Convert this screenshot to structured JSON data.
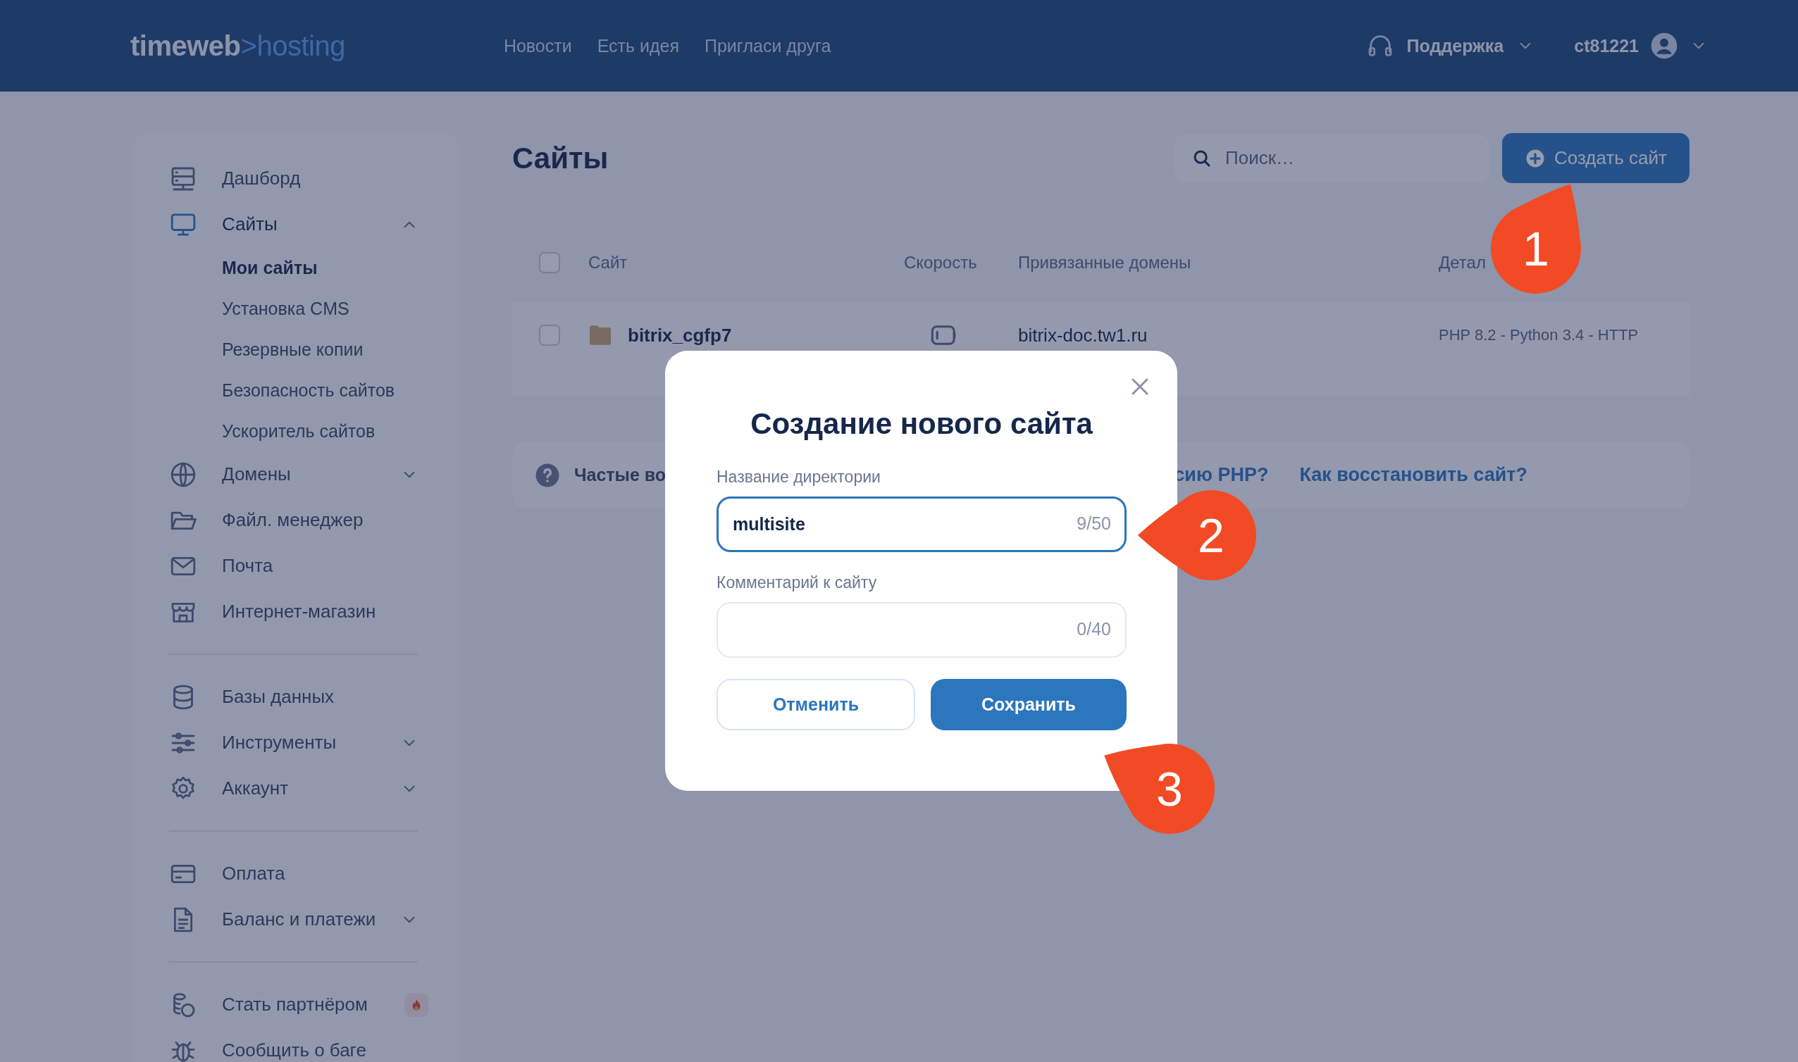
{
  "header": {
    "logo": {
      "brand": "timeweb",
      "separator": ">",
      "product": "hosting"
    },
    "nav": [
      "Новости",
      "Есть идея",
      "Пригласи друга"
    ],
    "support": "Поддержка",
    "user": "ct81221"
  },
  "sidebar": {
    "groups": [
      [
        {
          "label": "Дашборд",
          "selected": false
        },
        {
          "label": "Сайты",
          "selected": true,
          "expanded": true,
          "children": [
            {
              "label": "Мои сайты",
              "selected": true
            },
            {
              "label": "Установка CMS",
              "selected": false
            },
            {
              "label": "Резервные копии",
              "selected": false
            },
            {
              "label": "Безопасность сайтов",
              "selected": false
            },
            {
              "label": "Ускоритель сайтов",
              "selected": false
            }
          ]
        },
        {
          "label": "Домены",
          "selected": false,
          "expanded": false
        },
        {
          "label": "Файл. менеджер",
          "selected": false
        },
        {
          "label": "Почта",
          "selected": false
        },
        {
          "label": "Интернет-магазин",
          "selected": false
        }
      ],
      [
        {
          "label": "Базы данных",
          "selected": false
        },
        {
          "label": "Инструменты",
          "selected": false,
          "expanded": false
        },
        {
          "label": "Аккаунт",
          "selected": false,
          "expanded": false
        }
      ],
      [
        {
          "label": "Оплата",
          "selected": false
        },
        {
          "label": "Баланс и платежи",
          "selected": false,
          "expanded": false
        }
      ],
      [
        {
          "label": "Стать партнёром",
          "selected": false,
          "badge": true
        },
        {
          "label": "Сообщить о баге",
          "selected": false
        }
      ]
    ]
  },
  "page": {
    "title": "Сайты",
    "search": {
      "placeholder": "Поиск…"
    },
    "create_button": "Создать сайт"
  },
  "table": {
    "select_all": {
      "checked": false
    },
    "columns": [
      "Сайт",
      "Скорость",
      "Привязанные домены",
      "Детал"
    ],
    "rows": [
      {
        "checked": false,
        "site": "bitrix_cgfp7",
        "domain": "bitrix-doc.tw1.ru",
        "details": "PHP 8.2 - Python 3.4 - HTTP"
      }
    ]
  },
  "faq": {
    "label": "Частые во",
    "links": [
      "сию PHP?",
      "Как восстановить сайт?"
    ]
  },
  "dialog": {
    "title": "Создание нового сайта",
    "fields": [
      {
        "label": "Название директории",
        "value": "multisite",
        "counter": "9/50",
        "focused": true
      },
      {
        "label": "Комментарий к сайту",
        "counter": "0/40",
        "focused": false
      }
    ],
    "buttons": [
      {
        "label": "Отменить",
        "kind": "secondary"
      },
      {
        "label": "Сохранить",
        "kind": "primary"
      }
    ]
  },
  "callouts": [
    "1",
    "2",
    "3"
  ]
}
